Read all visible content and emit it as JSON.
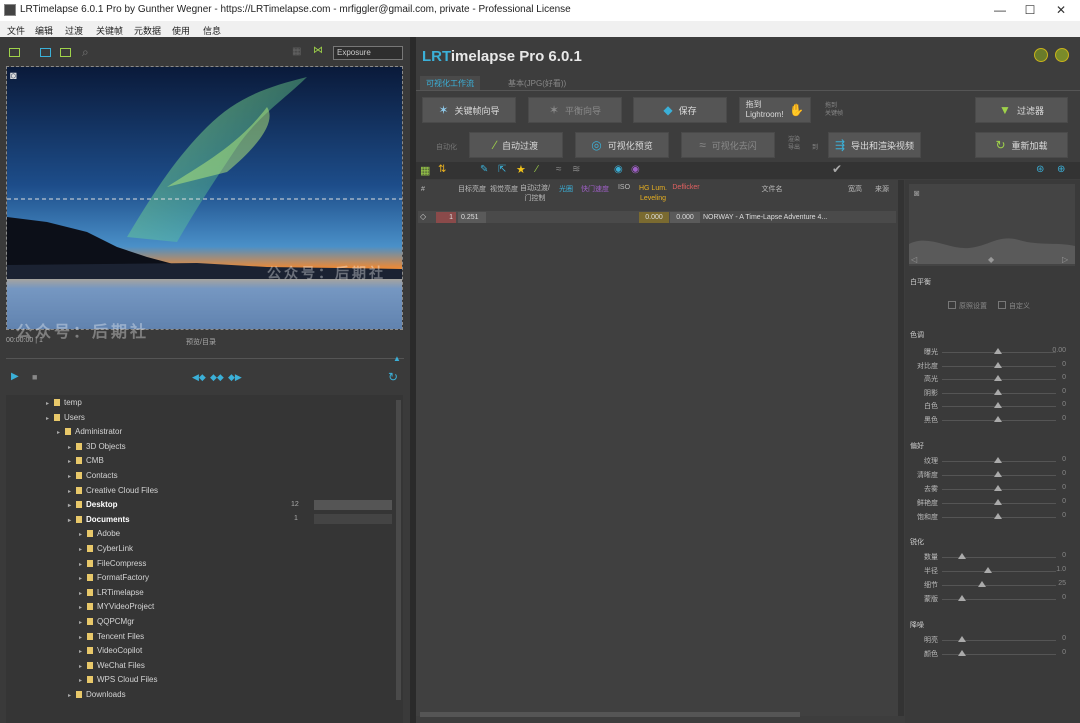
{
  "window": {
    "title": "LRTimelapse 6.0.1 Pro by Gunther Wegner - https://LRTimelapse.com - mrfiggler@gmail.com, private - Professional License",
    "minimize": "—",
    "maximize": "☐",
    "close": "✕"
  },
  "menu": [
    "文件",
    "编辑",
    "过渡",
    "关键帧",
    "元数据",
    "使用",
    "信息"
  ],
  "left": {
    "filter_dropdown": "Exposure",
    "preview_time": "00:00:00 | 1",
    "preview_caption": "预览/目录",
    "watermark_left": "公众号：后期社",
    "watermark_preview": "公众号：后期社",
    "tree": [
      {
        "label": "temp",
        "indent": 1,
        "bold": false
      },
      {
        "label": "Users",
        "indent": 1,
        "bold": false
      },
      {
        "label": "Administrator",
        "indent": 2,
        "bold": false
      },
      {
        "label": "3D Objects",
        "indent": 3,
        "bold": false
      },
      {
        "label": "CMB",
        "indent": 3,
        "bold": false
      },
      {
        "label": "Contacts",
        "indent": 3,
        "bold": false
      },
      {
        "label": "Creative Cloud Files",
        "indent": 3,
        "bold": false
      },
      {
        "label": "Desktop",
        "indent": 3,
        "bold": true
      },
      {
        "label": "Documents",
        "indent": 3,
        "bold": true
      },
      {
        "label": "Adobe",
        "indent": 4,
        "bold": false
      },
      {
        "label": "CyberLink",
        "indent": 4,
        "bold": false
      },
      {
        "label": "FileCompress",
        "indent": 4,
        "bold": false
      },
      {
        "label": "FormatFactory",
        "indent": 4,
        "bold": false
      },
      {
        "label": "LRTimelapse",
        "indent": 4,
        "bold": false
      },
      {
        "label": "MYVideoProject",
        "indent": 4,
        "bold": false
      },
      {
        "label": "QQPCMgr",
        "indent": 4,
        "bold": false
      },
      {
        "label": "Tencent Files",
        "indent": 4,
        "bold": false
      },
      {
        "label": "VideoCopilot",
        "indent": 4,
        "bold": false
      },
      {
        "label": "WeChat Files",
        "indent": 4,
        "bold": false
      },
      {
        "label": "WPS Cloud Files",
        "indent": 4,
        "bold": false
      },
      {
        "label": "Downloads",
        "indent": 3,
        "bold": false
      }
    ],
    "desktop_count": "12",
    "documents_count": "1"
  },
  "right": {
    "app_title_prefix": "LRT",
    "app_title_rest": "imelapse Pro 6.0.1",
    "tabs": [
      "可视化工作流",
      "基本(JPG(好看))"
    ],
    "buttons_row1": {
      "keyframe_wizard": "关键帧向导",
      "hdr_wizard": "平衡向导",
      "save": "保存",
      "to_lightroom_line1": "拖到",
      "to_lightroom_line2": "Lightroom!",
      "side_note_line1": "拖到",
      "side_note_line2": "关键帧",
      "filter": "过滤器"
    },
    "buttons_row2": {
      "hint": "自动化",
      "auto_transition": "自动过渡",
      "visual_preview": "可视化预览",
      "visual_deflicker": "可视化去闪",
      "side_label_line1": "渲染",
      "side_label_line2": "导出",
      "side_label_b": "到",
      "render_export": "导出和渲染视频",
      "reload": "重新加载"
    },
    "table": {
      "headers": [
        "#",
        "目标亮度",
        "视觉亮度",
        "自动过渡/门控制",
        "光圈",
        "快门速度",
        "ISO",
        "HG Lum. Leveling",
        "Deflicker",
        "文件名",
        "宽高",
        "来源"
      ],
      "row": {
        "num": "1",
        "brightness": "0.251",
        "hg": "0.000",
        "deflicker": "0.000",
        "filename": "NORWAY - A Time-Lapse Adventure 4..."
      }
    },
    "dev_panel": {
      "section_basic": "白平衡",
      "checkbox1": "原照设置",
      "checkbox2": "自定义",
      "section_tone": "色调",
      "tone": [
        {
          "label": "曝光",
          "value": "0.00"
        },
        {
          "label": "对比度",
          "value": "0"
        },
        {
          "label": "高光",
          "value": "0"
        },
        {
          "label": "阴影",
          "value": "0"
        },
        {
          "label": "白色",
          "value": "0"
        },
        {
          "label": "黑色",
          "value": "0"
        }
      ],
      "section_presence": "偏好",
      "presence": [
        {
          "label": "纹理",
          "value": "0"
        },
        {
          "label": "清晰度",
          "value": "0"
        },
        {
          "label": "去雾",
          "value": "0"
        },
        {
          "label": "鲜艳度",
          "value": "0"
        },
        {
          "label": "饱和度",
          "value": "0"
        }
      ],
      "section_sharpen": "锐化",
      "sharpen": [
        {
          "label": "数量",
          "value": "0"
        },
        {
          "label": "半径",
          "value": "1.0"
        },
        {
          "label": "细节",
          "value": "25"
        },
        {
          "label": "蒙版",
          "value": "0"
        }
      ],
      "section_noise": "降噪",
      "noise": [
        {
          "label": "明亮",
          "value": "0"
        },
        {
          "label": "颜色",
          "value": "0"
        }
      ]
    }
  }
}
